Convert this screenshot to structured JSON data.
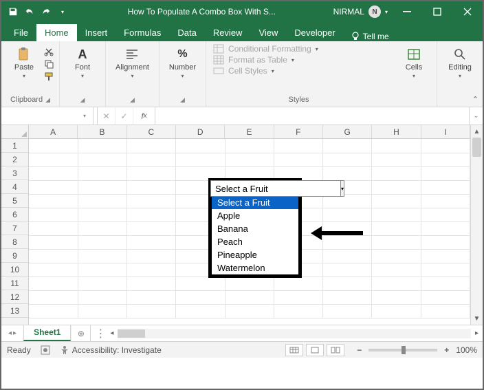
{
  "titlebar": {
    "title": "How To Populate A Combo Box With S...",
    "user_name": "NIRMAL",
    "user_initial": "N"
  },
  "tabs": {
    "file": "File",
    "home": "Home",
    "insert": "Insert",
    "formulas": "Formulas",
    "data": "Data",
    "review": "Review",
    "view": "View",
    "developer": "Developer",
    "tellme": "Tell me"
  },
  "ribbon": {
    "clipboard": {
      "label": "Clipboard",
      "paste": "Paste"
    },
    "font": {
      "label": "Font"
    },
    "alignment": {
      "label": "Alignment"
    },
    "number": {
      "label": "Number"
    },
    "styles": {
      "label": "Styles",
      "cond": "Conditional Formatting",
      "table": "Format as Table",
      "cell": "Cell Styles"
    },
    "cells": {
      "label": "Cells"
    },
    "editing": {
      "label": "Editing"
    }
  },
  "namebox": {
    "value": ""
  },
  "formula": {
    "value": ""
  },
  "columns": [
    "A",
    "B",
    "C",
    "D",
    "E",
    "F",
    "G",
    "H",
    "I"
  ],
  "rows": [
    "1",
    "2",
    "3",
    "4",
    "5",
    "6",
    "7",
    "8",
    "9",
    "10",
    "11",
    "12",
    "13"
  ],
  "combo": {
    "value": "Select a Fruit",
    "options": [
      "Select a Fruit",
      "Apple",
      "Banana",
      "Peach",
      "Pineapple",
      "Watermelon"
    ]
  },
  "sheet": {
    "name": "Sheet1"
  },
  "status": {
    "ready": "Ready",
    "accessibility": "Accessibility: Investigate",
    "zoom": "100%"
  }
}
